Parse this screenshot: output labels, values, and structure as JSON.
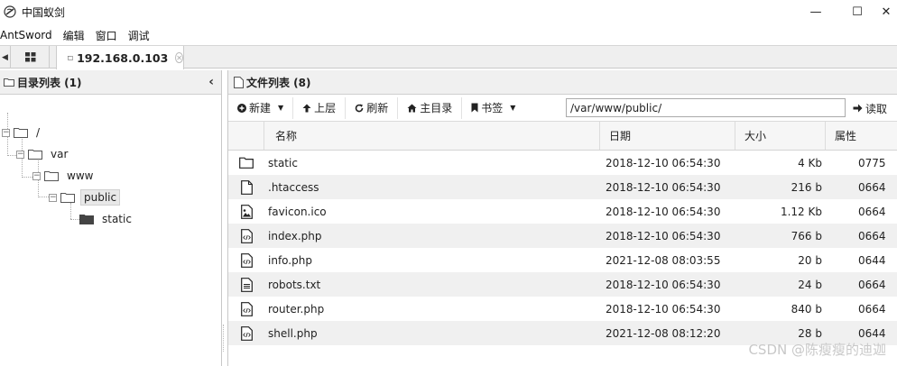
{
  "window": {
    "title": "中国蚁剑",
    "minimize": "—",
    "maximize": "☐",
    "close": "✕"
  },
  "menu": [
    "AntSword",
    "编辑",
    "窗口",
    "调试"
  ],
  "tabs": {
    "active_label": "192.168.0.103"
  },
  "left_panel": {
    "title": "目录列表 (1)",
    "tree": [
      {
        "label": "/"
      },
      {
        "label": "var"
      },
      {
        "label": "www"
      },
      {
        "label": "public",
        "selected": true
      },
      {
        "label": "static"
      }
    ]
  },
  "right_panel": {
    "title": "文件列表 (8)",
    "toolbar": {
      "new_label": "新建",
      "up_label": "上层",
      "refresh_label": "刷新",
      "home_label": "主目录",
      "bookmark_label": "书签",
      "path_value": "/var/www/public/",
      "read_label": "读取"
    },
    "columns": [
      "名称",
      "日期",
      "大小",
      "属性"
    ],
    "files": [
      {
        "icon": "folder-icon",
        "name": "static",
        "date": "2018-12-10 06:54:30",
        "size": "4 Kb",
        "perm": "0775"
      },
      {
        "icon": "file-icon",
        "name": ".htaccess",
        "date": "2018-12-10 06:54:30",
        "size": "216 b",
        "perm": "0664"
      },
      {
        "icon": "image-file-icon",
        "name": "favicon.ico",
        "date": "2018-12-10 06:54:30",
        "size": "1.12 Kb",
        "perm": "0664"
      },
      {
        "icon": "code-file-icon",
        "name": "index.php",
        "date": "2018-12-10 06:54:30",
        "size": "766 b",
        "perm": "0664"
      },
      {
        "icon": "code-file-icon",
        "name": "info.php",
        "date": "2021-12-08 08:03:55",
        "size": "20 b",
        "perm": "0644"
      },
      {
        "icon": "text-file-icon",
        "name": "robots.txt",
        "date": "2018-12-10 06:54:30",
        "size": "24 b",
        "perm": "0664"
      },
      {
        "icon": "code-file-icon",
        "name": "router.php",
        "date": "2018-12-10 06:54:30",
        "size": "840 b",
        "perm": "0664"
      },
      {
        "icon": "code-file-icon",
        "name": "shell.php",
        "date": "2021-12-08 08:12:20",
        "size": "28 b",
        "perm": "0644"
      }
    ]
  },
  "watermark": "CSDN @陈瘦瘦的迪迦"
}
